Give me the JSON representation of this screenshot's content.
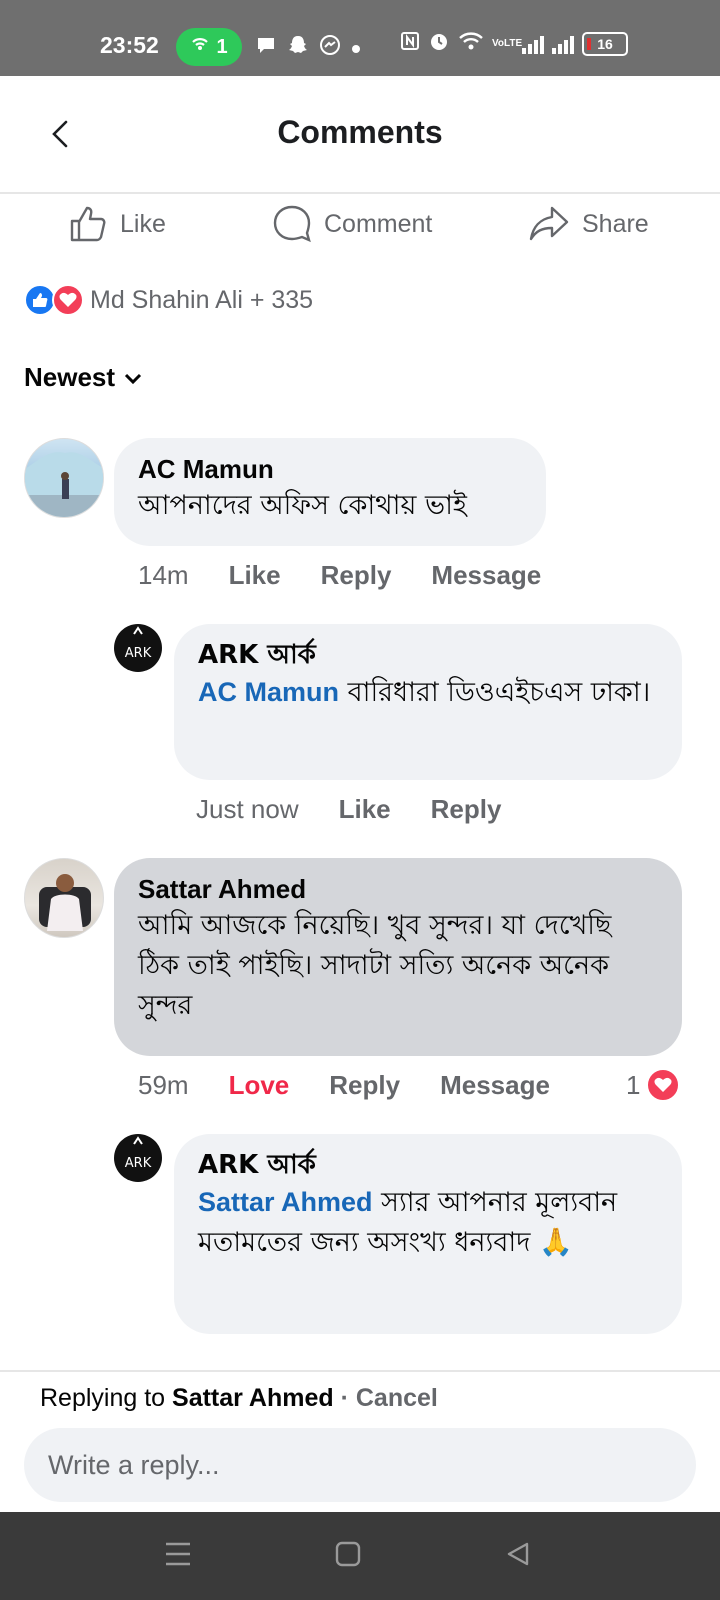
{
  "status_bar": {
    "time": "23:52",
    "hotspot_count": "1",
    "battery": "16",
    "network": "VoLTE"
  },
  "header": {
    "title": "Comments",
    "back_icon": "chevron-left-icon"
  },
  "post_actions": {
    "like_label": "Like",
    "comment_label": "Comment",
    "share_label": "Share"
  },
  "reactions": {
    "summary": "Md Shahin Ali + 335",
    "icons": [
      "like-reaction-icon",
      "love-reaction-icon"
    ]
  },
  "sort": {
    "label": "Newest"
  },
  "comments": [
    {
      "author": "AC Mamun",
      "text": "আপনাদের অফিস কোথায় ভাই",
      "time": "14m",
      "like": "Like",
      "reply": "Reply",
      "message": "Message",
      "replies": [
        {
          "author": "ARK আর্ক",
          "mention": "AC Mamun",
          "text": " বারিধারা ডিওএইচএস ঢাকা।",
          "time": "Just now",
          "like": "Like",
          "reply": "Reply"
        }
      ]
    },
    {
      "author": "Sattar Ahmed",
      "text": "আমি আজকে নিয়েছি। খুব সুন্দর। যা দেখেছি ঠিক তাই পাইছি। সাদাটা সত্যি অনেক অনেক সুন্দর",
      "time": "59m",
      "like": "Love",
      "reply": "Reply",
      "message": "Message",
      "reaction_count": "1",
      "replies": [
        {
          "author": "ARK আর্ক",
          "mention": "Sattar Ahmed",
          "text": " স্যার আপনার মূল্যবান মতামতের জন্য অসংখ্য ধন্যবাদ 🙏"
        }
      ]
    }
  ],
  "reply_bar": {
    "prefix": "Replying to ",
    "target": "Sattar Ahmed",
    "cancel": " · Cancel",
    "placeholder": "Write a reply..."
  },
  "colors": {
    "link_blue": "#1867b7",
    "love_red": "#f02849",
    "like_blue": "#1877f2",
    "bubble": "#f0f2f5"
  }
}
